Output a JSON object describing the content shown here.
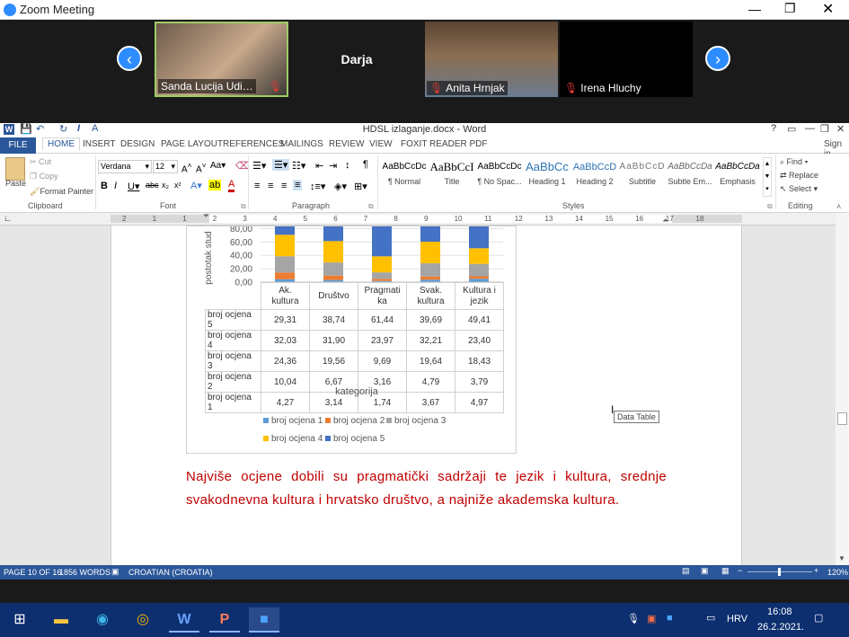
{
  "zoom": {
    "title": "Zoom Meeting",
    "participants": [
      {
        "name": "Sanda Lucija Udi…",
        "muted": true
      },
      {
        "name": "Darja",
        "muted": false
      },
      {
        "name": "Anita Hrnjak",
        "muted": true
      },
      {
        "name": "Irena Hluchy",
        "muted": true
      }
    ]
  },
  "word": {
    "doc_title": "HDSL izlaganje.docx - Word",
    "sign_in": "Sign in",
    "tabs": [
      "FILE",
      "HOME",
      "INSERT",
      "DESIGN",
      "PAGE LAYOUT",
      "REFERENCES",
      "MAILINGS",
      "REVIEW",
      "VIEW",
      "FOXIT READER PDF"
    ],
    "clipboard": {
      "paste": "Paste",
      "cut": "Cut",
      "copy": "Copy",
      "format_painter": "Format Painter",
      "label": "Clipboard"
    },
    "font": {
      "name": "Verdana",
      "size": "12",
      "label": "Font"
    },
    "paragraph_label": "Paragraph",
    "styles": {
      "label": "Styles",
      "items": [
        {
          "preview": "AaBbCcDc",
          "name": "¶ Normal"
        },
        {
          "preview": "AaBbCcI",
          "name": "Title"
        },
        {
          "preview": "AaBbCcDc",
          "name": "¶ No Spac..."
        },
        {
          "preview": "AaBbCc",
          "name": "Heading 1"
        },
        {
          "preview": "AaBbCcD",
          "name": "Heading 2"
        },
        {
          "preview": "AaBbCcD",
          "name": "Subtitle"
        },
        {
          "preview": "AaBbCcDa",
          "name": "Subtle Em..."
        },
        {
          "preview": "AaBbCcDa",
          "name": "Emphasis"
        }
      ]
    },
    "editing": {
      "find": "Find",
      "replace": "Replace",
      "select": "Select",
      "label": "Editing"
    },
    "ruler_numbers": [
      "2",
      "1",
      "1",
      "2",
      "3",
      "4",
      "5",
      "6",
      "7",
      "8",
      "9",
      "10",
      "11",
      "12",
      "13",
      "14",
      "15",
      "16",
      "17",
      "18"
    ],
    "tooltip": "Data Table",
    "paragraph_text": "Najviše ocjene dobili su pragmatički sadržaji te jezik i kultura, srednje svakodnevna kultura i hrvatsko društvo, a najniže akademska kultura.",
    "status": {
      "page": "PAGE 10 OF 16",
      "words": "1856 WORDS",
      "language": "CROATIAN (CROATIA)",
      "zoom": "120%"
    }
  },
  "chart_data": {
    "type": "bar",
    "stacked": true,
    "ylabel": "postotak stud",
    "xlabel": "kategorija",
    "y_ticks": [
      "80,00",
      "60,00",
      "40,00",
      "20,00",
      "0,00"
    ],
    "ylim": [
      0,
      100
    ],
    "categories": [
      "Ak. kultura",
      "Društvo",
      "Pragmatika",
      "Svak. kultura",
      "Kultura i jezik"
    ],
    "category_labels": [
      [
        "Ak.",
        "kultura"
      ],
      [
        "Društvo"
      ],
      [
        "Pragmati",
        "ka"
      ],
      [
        "Svak.",
        "kultura"
      ],
      [
        "Kultura i",
        "jezik"
      ]
    ],
    "series": [
      {
        "name": "broj ocjena 5",
        "color": "#4472c4",
        "values": [
          "29,31",
          "38,74",
          "61,44",
          "39,69",
          "49,41"
        ]
      },
      {
        "name": "broj ocjena 4",
        "color": "#ffc000",
        "values": [
          "32,03",
          "31,90",
          "23,97",
          "32,21",
          "23,40"
        ]
      },
      {
        "name": "broj ocjena 3",
        "color": "#a5a5a5",
        "values": [
          "24,36",
          "19,56",
          "9,69",
          "19,64",
          "18,43"
        ]
      },
      {
        "name": "broj ocjena 2",
        "color": "#ed7d31",
        "values": [
          "10,04",
          "6,67",
          "3,16",
          "4,79",
          "3,79"
        ]
      },
      {
        "name": "broj ocjena 1",
        "color": "#5b9bd5",
        "values": [
          "4,27",
          "3,14",
          "1,74",
          "3,67",
          "4,97"
        ]
      }
    ],
    "legend": [
      "broj ocjena 1",
      "broj ocjena 2",
      "broj ocjena 3",
      "broj ocjena 4",
      "broj ocjena 5"
    ]
  },
  "taskbar": {
    "lang": "HRV",
    "time": "16:08",
    "date": "26.2.2021."
  }
}
